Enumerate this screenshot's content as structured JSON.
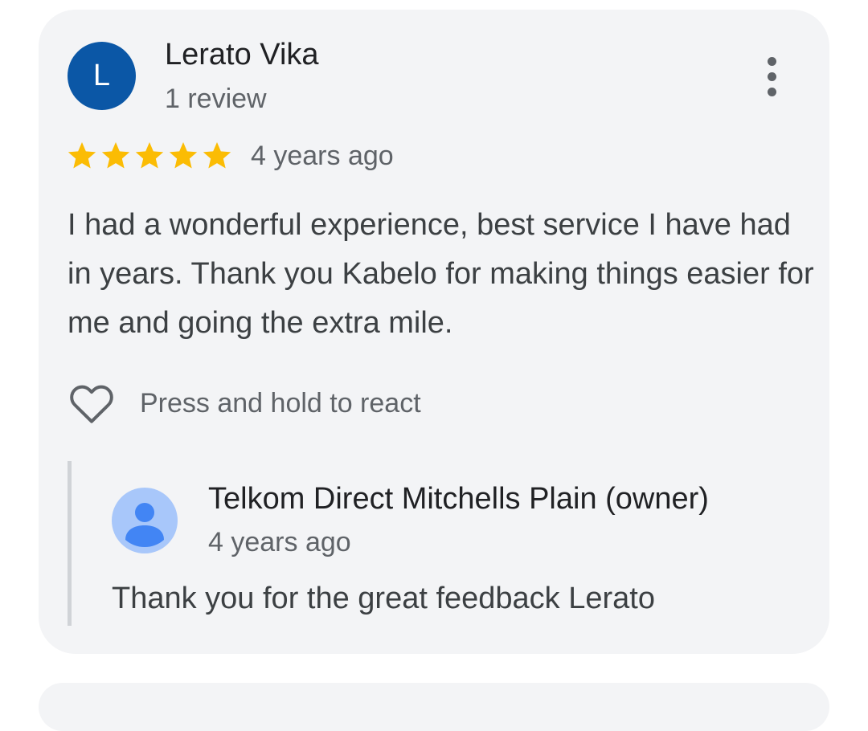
{
  "review": {
    "avatar_letter": "L",
    "avatar_color": "#0b57a6",
    "reviewer_name": "Lerato Vika",
    "review_count": "1 review",
    "more_icon": "more-vertical-icon",
    "rating": 5,
    "rating_max": 5,
    "star_color": "#fbbc04",
    "date": "4 years ago",
    "text": "I had a wonderful experience, best service I have had in years. Thank you Kabelo for making things easier for me and going the extra mile.",
    "react_icon": "heart-outline-icon",
    "react_label": "Press and hold to react"
  },
  "owner_reply": {
    "avatar_icon": "default-profile-icon",
    "name": "Telkom Direct Mitchells Plain (owner)",
    "date": "4 years ago",
    "text": "Thank you for the great feedback Lerato"
  }
}
